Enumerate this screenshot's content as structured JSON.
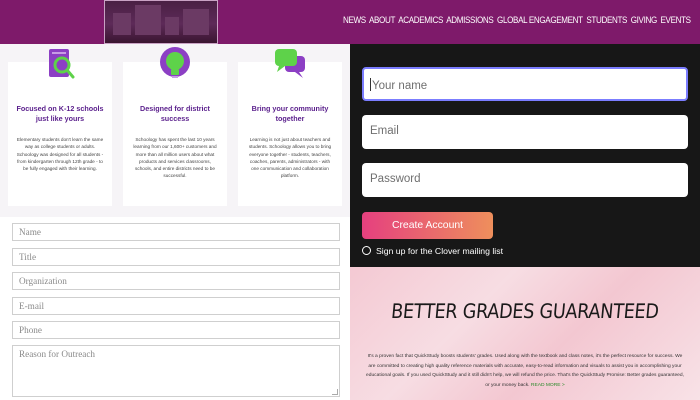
{
  "nav": {
    "items": [
      "NEWS",
      "ABOUT",
      "ACADEMICS",
      "ADMISSIONS",
      "GLOBAL ENGAGEMENT",
      "STUDENTS",
      "GIVING",
      "EVENTS"
    ]
  },
  "features": [
    {
      "title": "Focused on K-12 schools just like yours",
      "text": "Elementary students don't learn the same way as college students or adults. Schoology was designed for all students - from kindergarten through 12th grade - to be fully engaged with their learning.",
      "icon": "book-magnifier-icon",
      "color": "#8c3fc4"
    },
    {
      "title": "Designed for district success",
      "text": "Schoology has spent the last 10 years learning from our 1,600+ customers and more than all million users about what products and services classrooms, schools, and entire districts need to be successful.",
      "icon": "lightbulb-icon",
      "color": "#5ed24a"
    },
    {
      "title": "Bring your community together",
      "text": "Learning is not just about teachers and students. Schoology allows you to bring everyone together - students, teachers, coaches, parents, administrators - with one communication and collaboration platform.",
      "icon": "chat-bubbles-icon",
      "color": "#8c3fc4"
    }
  ],
  "outreach_form": {
    "name_placeholder": "Name",
    "title_placeholder": "Title",
    "organization_placeholder": "Organization",
    "email_placeholder": "E-mail",
    "phone_placeholder": "Phone",
    "reason_placeholder": "Reason for Outreach"
  },
  "signup": {
    "name_placeholder": "Your name",
    "email_placeholder": "Email",
    "password_placeholder": "Password",
    "create_label": "Create Account",
    "mailing_label": "Sign up for the Clover mailing list"
  },
  "promo": {
    "heading": "BETTER GRADES GUARANTEED",
    "body": "It's a proven fact that QuickStudy boosts students' grades. Used along with the textbook and class notes, it's the perfect resource for success. We are committed to creating high quality reference materials with accurate, easy-to-read information and visuals to assist you in accomplishing your educational goals. If you used QuickStudy and it still didn't help, we will refund the price. That's the QuickStudy Promise: Better grades guaranteed, or your money back.",
    "link_label": "READ MORE >"
  },
  "colors": {
    "header": "#7e1a6a",
    "feature_title": "#5a1f8c",
    "button_start": "#e5407f",
    "button_end": "#ee8f5c",
    "focus_border": "#7b7dff"
  }
}
